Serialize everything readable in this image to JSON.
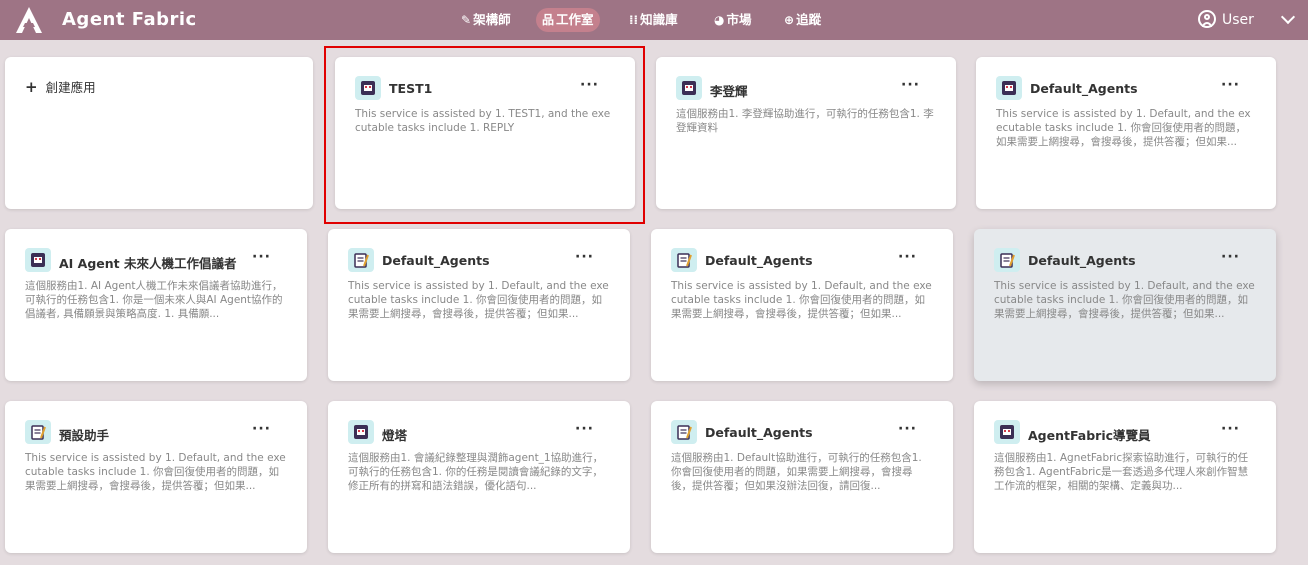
{
  "app": {
    "title": "Agent Fabric",
    "accent_color": "#9e7485",
    "active_tab_color": "#c4808d",
    "highlight_color": "#e00000"
  },
  "nav": [
    {
      "icon": "wand-icon",
      "glyph": "✎",
      "label": "架構師"
    },
    {
      "icon": "workshop-icon",
      "glyph": "品",
      "label": "工作室",
      "active": true
    },
    {
      "icon": "grid-icon",
      "glyph": "⁞⁞",
      "label": "知識庫"
    },
    {
      "icon": "globe-icon",
      "glyph": "◕",
      "label": "市場"
    },
    {
      "icon": "search-icon",
      "glyph": "⊕",
      "label": "追蹤"
    }
  ],
  "user": {
    "label": "User"
  },
  "create": {
    "label": "創建應用"
  },
  "cards": [
    {
      "icon": "robot-icon",
      "title": "TEST1",
      "desc": "This service is assisted by 1. TEST1, and the executable tasks include 1. REPLY",
      "highlighted": true
    },
    {
      "icon": "robot-icon",
      "title": "李登輝",
      "desc": "這個服務由1. 李登輝協助進行，可執行的任務包含1. 李登輝資料"
    },
    {
      "icon": "robot-icon",
      "title": "Default_Agents",
      "desc": "This service is assisted by 1. Default, and the executable tasks include 1. 你會回復使用者的問題，如果需要上網搜尋，會搜尋後，提供答覆；但如果..."
    },
    {
      "icon": "robot-icon",
      "title": "AI Agent 未來人機工作倡議者",
      "desc": "這個服務由1. AI Agent人機工作未來倡議者協助進行，可執行的任務包含1. 你是一個未來人與AI Agent協作的倡議者, 具備願景與策略高度. 1. 具備願..."
    },
    {
      "icon": "notepad-icon",
      "title": "Default_Agents",
      "desc": "This service is assisted by 1. Default, and the executable tasks include 1. 你會回復使用者的問題，如果需要上網搜尋，會搜尋後，提供答覆；但如果..."
    },
    {
      "icon": "notepad-icon",
      "title": "Default_Agents",
      "desc": "This service is assisted by 1. Default, and the executable tasks include 1. 你會回復使用者的問題，如果需要上網搜尋，會搜尋後，提供答覆；但如果..."
    },
    {
      "icon": "notepad-icon",
      "title": "Default_Agents",
      "desc": "This service is assisted by 1. Default, and the executable tasks include 1. 你會回復使用者的問題，如果需要上網搜尋，會搜尋後，提供答覆；但如果...",
      "hovered": true
    },
    {
      "icon": "notepad-icon",
      "title": "預設助手",
      "desc": "This service is assisted by 1. Default, and the executable tasks include 1. 你會回復使用者的問題，如果需要上網搜尋，會搜尋後，提供答覆；但如果..."
    },
    {
      "icon": "robot-icon",
      "title": "燈塔",
      "desc": "這個服務由1. 會議紀錄整理與潤飾agent_1協助進行，可執行的任務包含1. 你的任務是閱讀會議紀錄的文字，修正所有的拼寫和語法錯誤，優化語句..."
    },
    {
      "icon": "notepad-icon",
      "title": "Default_Agents",
      "desc": "這個服務由1. Default協助進行，可執行的任務包含1. 你會回復使用者的問題，如果需要上網搜尋，會搜尋後，提供答覆；但如果沒辦法回復，請回復..."
    },
    {
      "icon": "robot-icon",
      "title": "AgentFabric導覽員",
      "desc": "這個服務由1. AgnetFabric探索協助進行，可執行的任務包含1. AgentFabric是一套透過多代理人來創作智慧工作流的框架，相關的架構、定義與功..."
    }
  ],
  "more_label": "···"
}
